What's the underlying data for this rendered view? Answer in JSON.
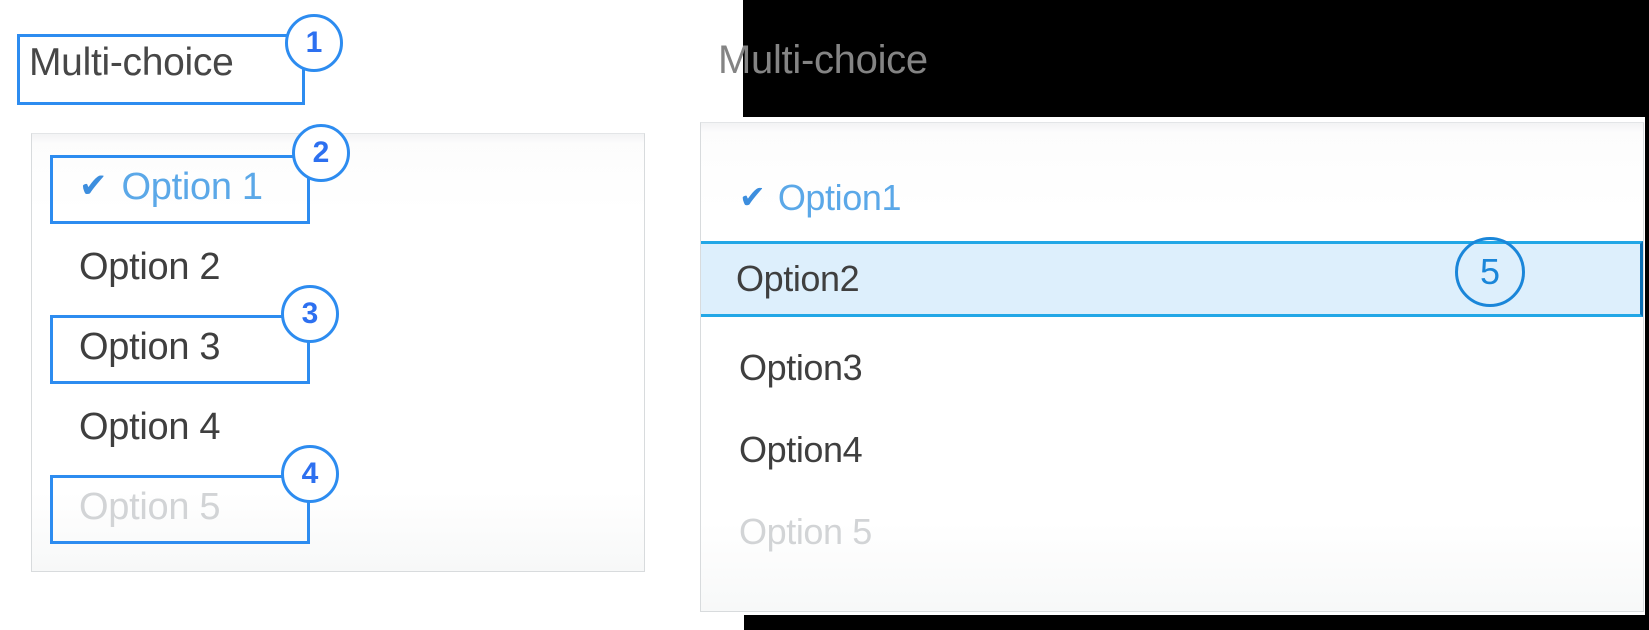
{
  "title": "Multi-choice annotated dropdown comparison",
  "left": {
    "title_label": "Multi-choice",
    "options": [
      {
        "label": "Option 1",
        "state": "selected",
        "icon": "check-icon",
        "has_check": true
      },
      {
        "label": "Option 2",
        "state": "normal",
        "icon": "",
        "has_check": false
      },
      {
        "label": "Option 3",
        "state": "normal",
        "icon": "",
        "has_check": false
      },
      {
        "label": "Option 4",
        "state": "normal",
        "icon": "",
        "has_check": false
      },
      {
        "label": "Option 5",
        "state": "disabled",
        "icon": "",
        "has_check": false
      }
    ]
  },
  "right": {
    "title_label": "Multi-choice",
    "options": [
      {
        "label": "Option1",
        "state": "selected",
        "icon": "check-icon",
        "has_check": true
      },
      {
        "label": "Option2",
        "state": "highlighted",
        "icon": "",
        "has_check": false
      },
      {
        "label": "Option3",
        "state": "normal",
        "icon": "",
        "has_check": false
      },
      {
        "label": "Option4",
        "state": "normal",
        "icon": "",
        "has_check": false
      },
      {
        "label": "Option 5",
        "state": "disabled",
        "icon": "",
        "has_check": false
      }
    ]
  },
  "annotations": [
    {
      "number": "1",
      "target": "title-field",
      "style": "dark"
    },
    {
      "number": "2",
      "target": "option-1-selected",
      "style": "dark"
    },
    {
      "number": "3",
      "target": "option-3",
      "style": "dark"
    },
    {
      "number": "4",
      "target": "option-5-disabled",
      "style": "dark"
    },
    {
      "number": "5",
      "target": "option-2-highlight",
      "style": "light"
    }
  ],
  "glyphs": {
    "check": "✔"
  },
  "colors": {
    "annotation_blue": "#2d8cf0",
    "annotation_number": "#2d70f0",
    "callout_light": "#1a86d9",
    "selected_text": "#5ba8e8",
    "check_blue": "#3d8ede",
    "normal_text": "#3f3f3f",
    "disabled_text": "#d2d4d6",
    "title_left": "#474747",
    "title_right": "#848484",
    "highlight_fill": "#ddeffc",
    "highlight_border": "#22a7e6",
    "panel_border": "#d8dbdd",
    "backdrop": "#000000"
  }
}
